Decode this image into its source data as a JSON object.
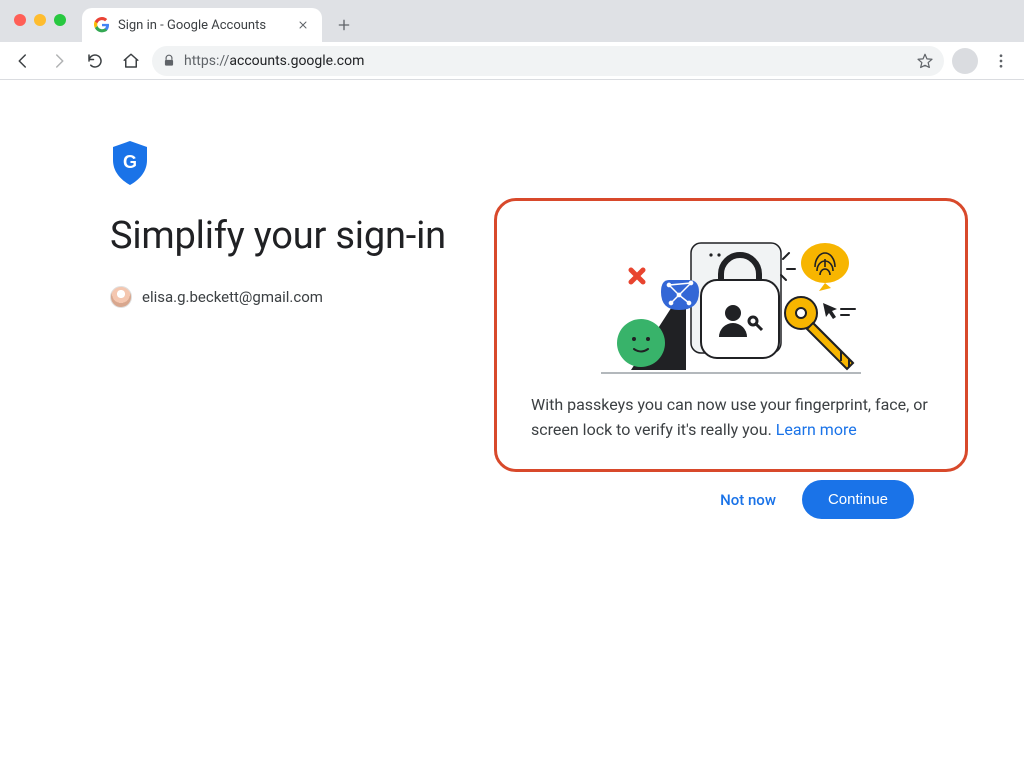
{
  "browser": {
    "tab_title": "Sign in - Google Accounts",
    "url_protocol": "https://",
    "url_rest": "accounts.google.com"
  },
  "page": {
    "headline": "Simplify your sign-in",
    "account_email": "elisa.g.beckett@gmail.com",
    "card_body": "With passkeys you can now use your fingerprint, face, or screen lock to verify it's really you. ",
    "learn_more": "Learn more",
    "not_now": "Not now",
    "continue": "Continue"
  },
  "colors": {
    "highlight_border": "#d8492b",
    "primary": "#1a73e8"
  }
}
